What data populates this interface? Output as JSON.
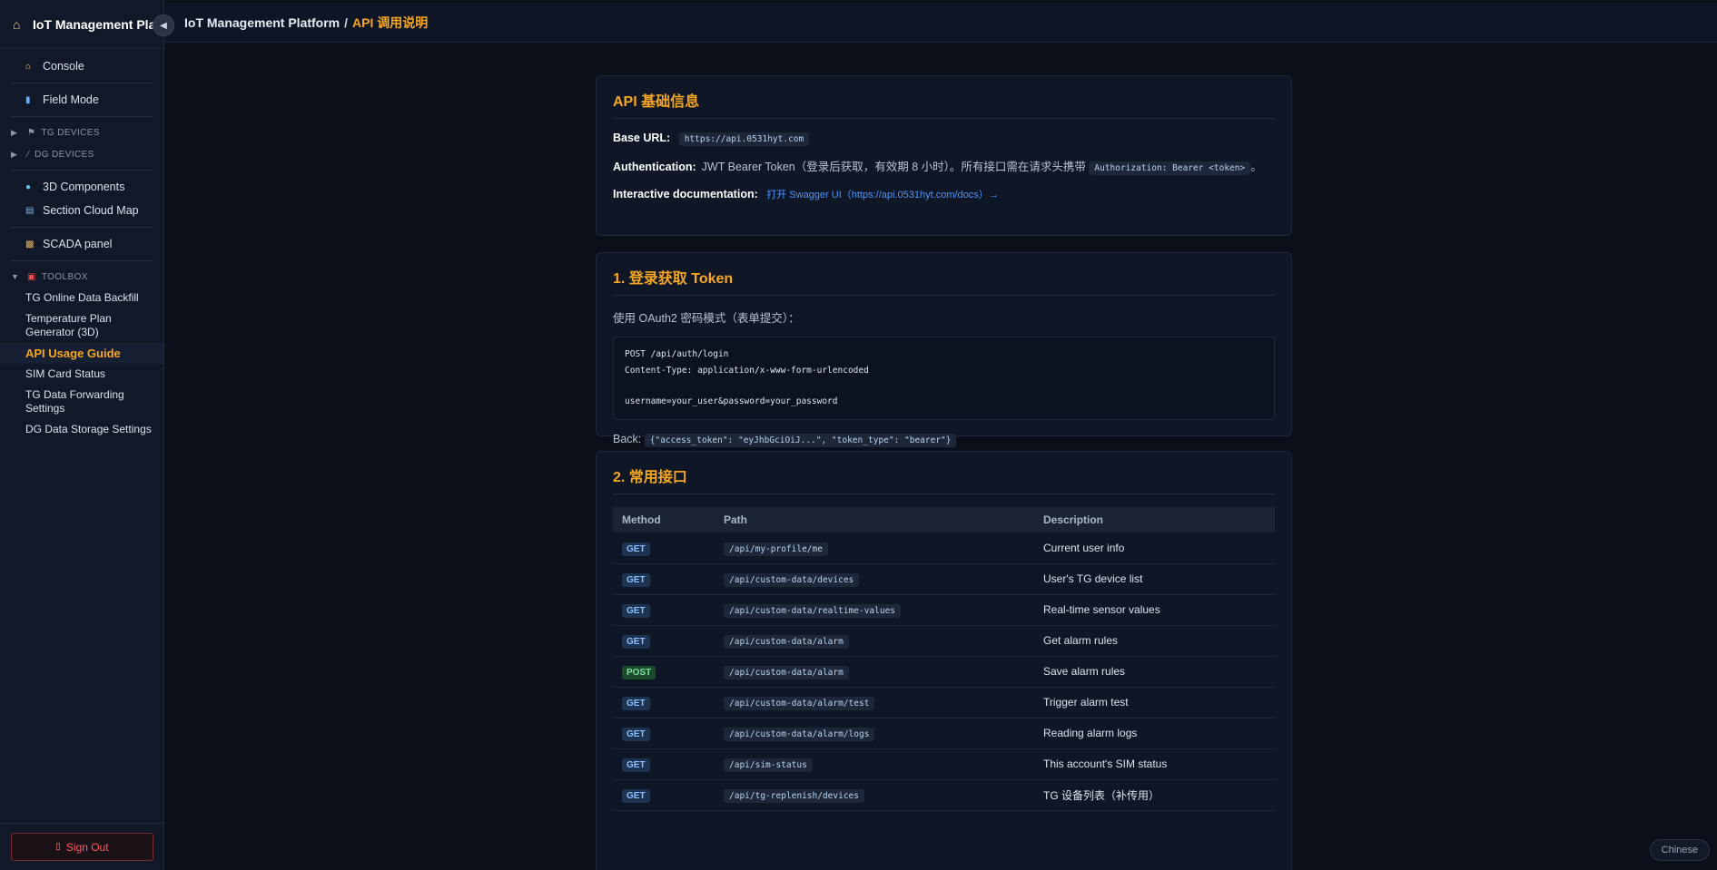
{
  "sidebar": {
    "brand": "IoT Management Plat",
    "collapse_icon": "chevron-left-icon",
    "items": {
      "console": "Console",
      "field_mode": "Field Mode",
      "tg_devices": "TG DEVICES",
      "dg_devices": "DG DEVICES",
      "components_3d": "3D Components",
      "section_cloud_map": "Section Cloud Map",
      "scada_panel": "SCADA panel",
      "toolbox": "TOOLBOX"
    },
    "toolbox": [
      "TG Online Data Backfill",
      "Temperature Plan Generator (3D)",
      "API Usage Guide",
      "SIM Card Status",
      "TG Data Forwarding Settings",
      "DG Data Storage Settings"
    ],
    "active": "API Usage Guide",
    "sign_out": "Sign Out"
  },
  "header": {
    "root": "IoT Management Platform",
    "separator": "/",
    "current": "API 调用说明"
  },
  "card_basic": {
    "title": "API 基础信息",
    "base_url_label": "Base URL:",
    "base_url": "https://api.0531hyt.com",
    "auth_label": "Authentication:",
    "auth_text": "JWT Bearer Token（登录后获取，有效期 8 小时）。所有接口需在请求头携带",
    "auth_header": "Authorization: Bearer <token>",
    "auth_end": "。",
    "docs_label": "Interactive documentation:",
    "docs_link": "打开 Swagger UI（https://api.0531hyt.com/docs）→"
  },
  "card_login": {
    "title": "1. 登录获取 Token",
    "intro": "使用 OAuth2 密码模式（表单提交）：",
    "code_line1": "POST /api/auth/login",
    "code_line2": "Content-Type: application/x-www-form-urlencoded",
    "code_line3": "username=your_user&password=your_password",
    "back_label": "Back:",
    "back_value": "{\"access_token\": \"eyJhbGciOiJ...\", \"token_type\": \"bearer\"}"
  },
  "card_endpoints": {
    "title": "2. 常用接口",
    "columns": [
      "Method",
      "Path",
      "Description"
    ],
    "rows": [
      {
        "method": "GET",
        "path": "/api/my-profile/me",
        "desc": "Current user info"
      },
      {
        "method": "GET",
        "path": "/api/custom-data/devices",
        "desc": "User's TG device list"
      },
      {
        "method": "GET",
        "path": "/api/custom-data/realtime-values",
        "desc": "Real-time sensor values"
      },
      {
        "method": "GET",
        "path": "/api/custom-data/alarm",
        "desc": "Get alarm rules"
      },
      {
        "method": "POST",
        "path": "/api/custom-data/alarm",
        "desc": "Save alarm rules"
      },
      {
        "method": "GET",
        "path": "/api/custom-data/alarm/test",
        "desc": "Trigger alarm test"
      },
      {
        "method": "GET",
        "path": "/api/custom-data/alarm/logs",
        "desc": "Reading alarm logs"
      },
      {
        "method": "GET",
        "path": "/api/sim-status",
        "desc": "This account's SIM status"
      },
      {
        "method": "GET",
        "path": "/api/tg-replenish/devices",
        "desc": "TG 设备列表（补传用）"
      }
    ]
  },
  "language_button": "Chinese",
  "colors": {
    "accent": "#f5a623",
    "link": "#4d94ff",
    "danger": "#ff5a5f"
  }
}
